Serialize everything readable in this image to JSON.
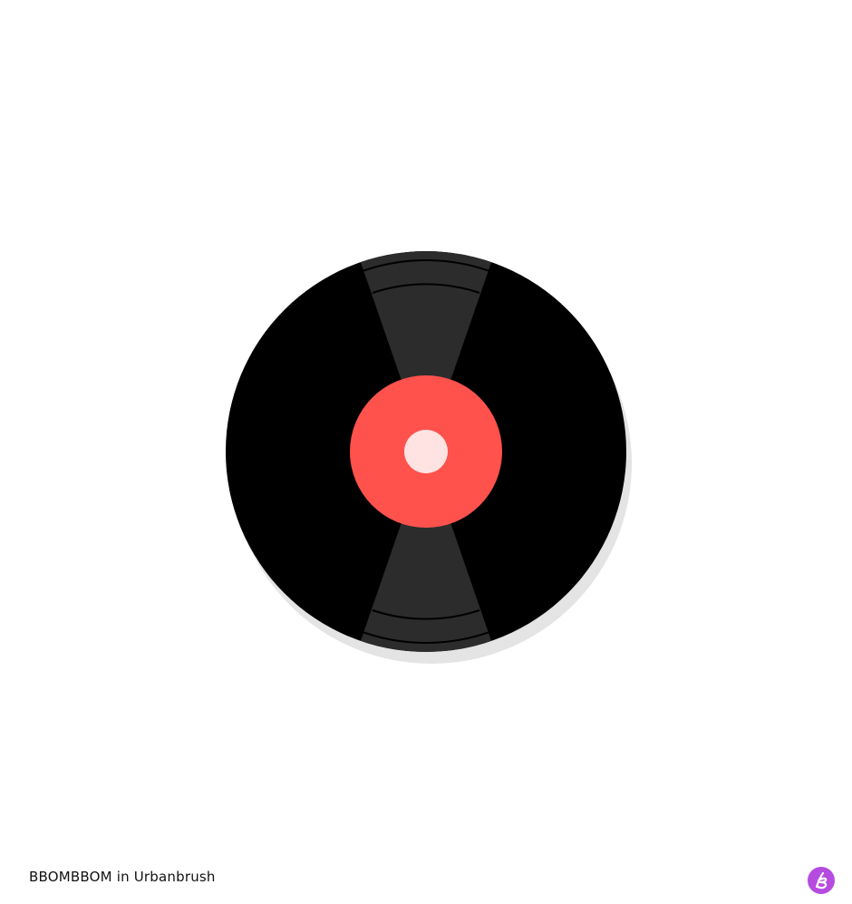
{
  "caption": {
    "text": "BBOMBBOM in Urbanbrush"
  },
  "brand": {
    "icon": "urbanbrush-logo-icon",
    "color": "#b64be0"
  },
  "artwork": {
    "subject": "vinyl-record-icon",
    "colors": {
      "disc": "#000000",
      "shine": "#2c2c2c",
      "shadow": "#e4e4e4",
      "label": "#ff524c",
      "spindle_hole": "#ffe3e3"
    }
  }
}
